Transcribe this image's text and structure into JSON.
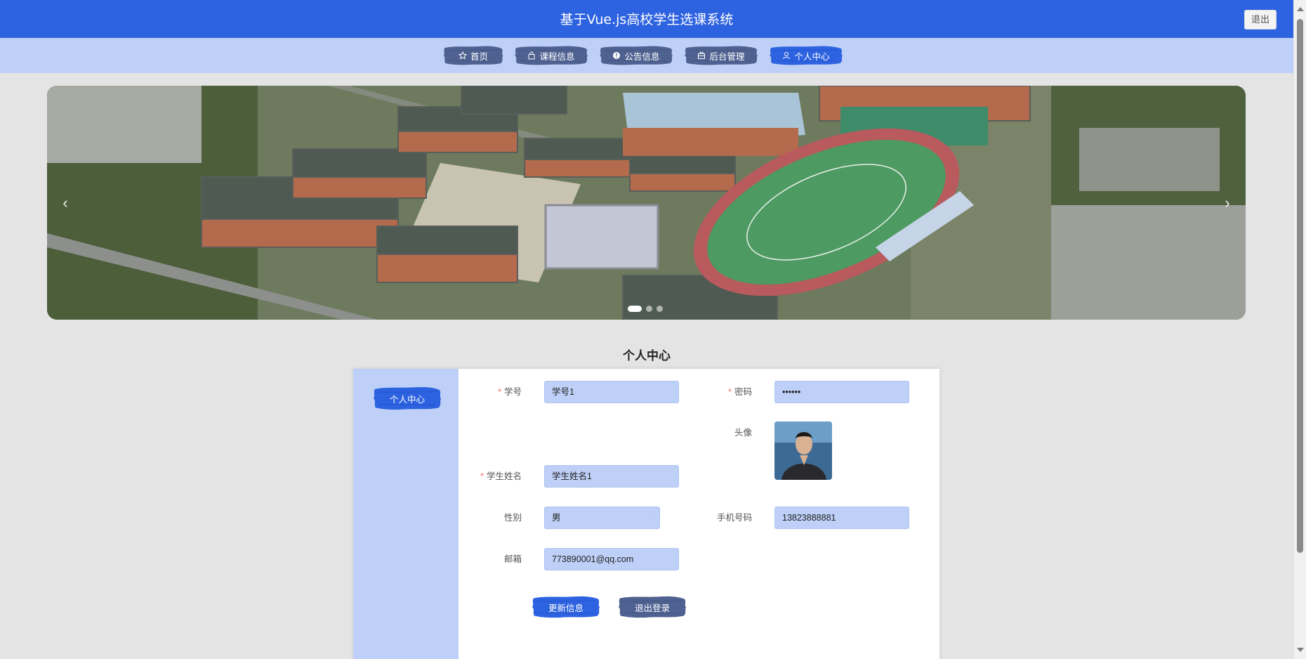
{
  "header": {
    "title": "基于Vue.js高校学生选课系统",
    "logout_label": "退出"
  },
  "nav": {
    "items": [
      {
        "label": "首页",
        "icon": "star-icon"
      },
      {
        "label": "课程信息",
        "icon": "bag-icon"
      },
      {
        "label": "公告信息",
        "icon": "info-icon"
      },
      {
        "label": "后台管理",
        "icon": "briefcase-icon"
      },
      {
        "label": "个人中心",
        "icon": "user-icon",
        "active": true
      }
    ]
  },
  "carousel": {
    "prev": "‹",
    "next": "›",
    "slide_count": 3,
    "active_index": 0
  },
  "section": {
    "title": "个人中心"
  },
  "sidebar": {
    "items": [
      {
        "label": "个人中心"
      }
    ]
  },
  "form": {
    "student_id": {
      "label": "学号",
      "value": "学号1",
      "required": true
    },
    "password": {
      "label": "密码",
      "value": "••••••",
      "required": true
    },
    "avatar": {
      "label": "头像"
    },
    "student_name": {
      "label": "学生姓名",
      "value": "学生姓名1",
      "required": true
    },
    "gender": {
      "label": "性别",
      "value": "男"
    },
    "phone": {
      "label": "手机号码",
      "value": "13823888881"
    },
    "email": {
      "label": "邮箱",
      "value": "773890001@qq.com"
    },
    "update_label": "更新信息",
    "logout_label": "退出登录"
  },
  "colors": {
    "primary": "#2d62e0",
    "light": "#bed0f7",
    "background": "#e4e4e4"
  }
}
